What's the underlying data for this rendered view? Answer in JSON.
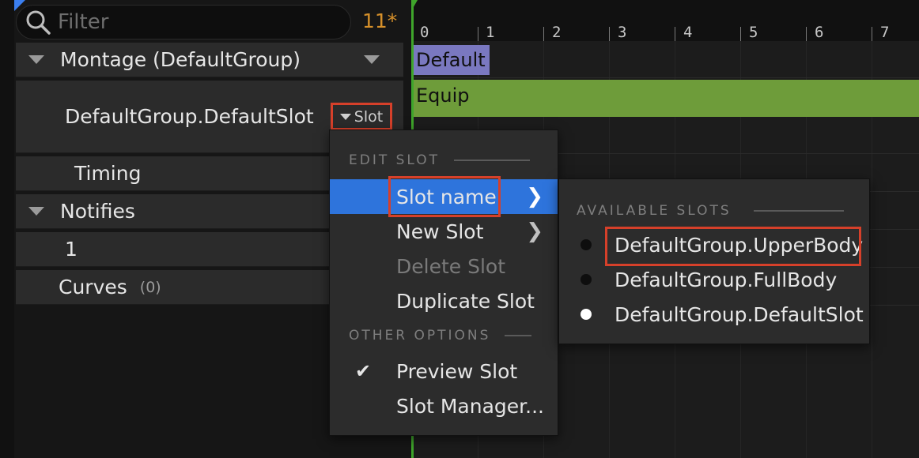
{
  "filter": {
    "placeholder": "Filter",
    "count": "11*"
  },
  "tracks": {
    "montage_label": "Montage (DefaultGroup)",
    "slot_label": "DefaultGroup.DefaultSlot",
    "slot_button_label": "Slot",
    "timing_label": "Timing",
    "notifies_label": "Notifies",
    "notify_row_label": "1",
    "curves_label": "Curves",
    "curves_count": "(0)"
  },
  "timeline": {
    "ticks": [
      "0",
      "1",
      "2",
      "3",
      "4",
      "5",
      "6",
      "7"
    ],
    "sections": [
      "Default",
      "Equip"
    ]
  },
  "context_menu": {
    "edit_heading": "EDIT SLOT",
    "items": [
      {
        "label": "Slot name",
        "has_submenu": true,
        "active": true
      },
      {
        "label": "New Slot",
        "has_submenu": true
      },
      {
        "label": "Delete Slot",
        "disabled": true
      },
      {
        "label": "Duplicate Slot"
      }
    ],
    "other_heading": "OTHER OPTIONS",
    "other_items": [
      {
        "label": "Preview Slot",
        "checked": true
      },
      {
        "label": "Slot Manager..."
      }
    ],
    "chevron_icon": "chevron-right-icon",
    "check_icon": "checkmark-icon"
  },
  "submenu": {
    "heading": "AVAILABLE SLOTS",
    "slots": [
      {
        "label": "DefaultGroup.UpperBody",
        "selected": false
      },
      {
        "label": "DefaultGroup.FullBody",
        "selected": false
      },
      {
        "label": "DefaultGroup.DefaultSlot",
        "selected": true
      }
    ]
  },
  "colors": {
    "highlight_outline": "#d6402a",
    "menu_active": "#2e74dc",
    "section_default": "#7a78c0",
    "section_equip": "#6e9c3a",
    "playhead": "#3fa52b",
    "filter_count": "#d6902a"
  }
}
